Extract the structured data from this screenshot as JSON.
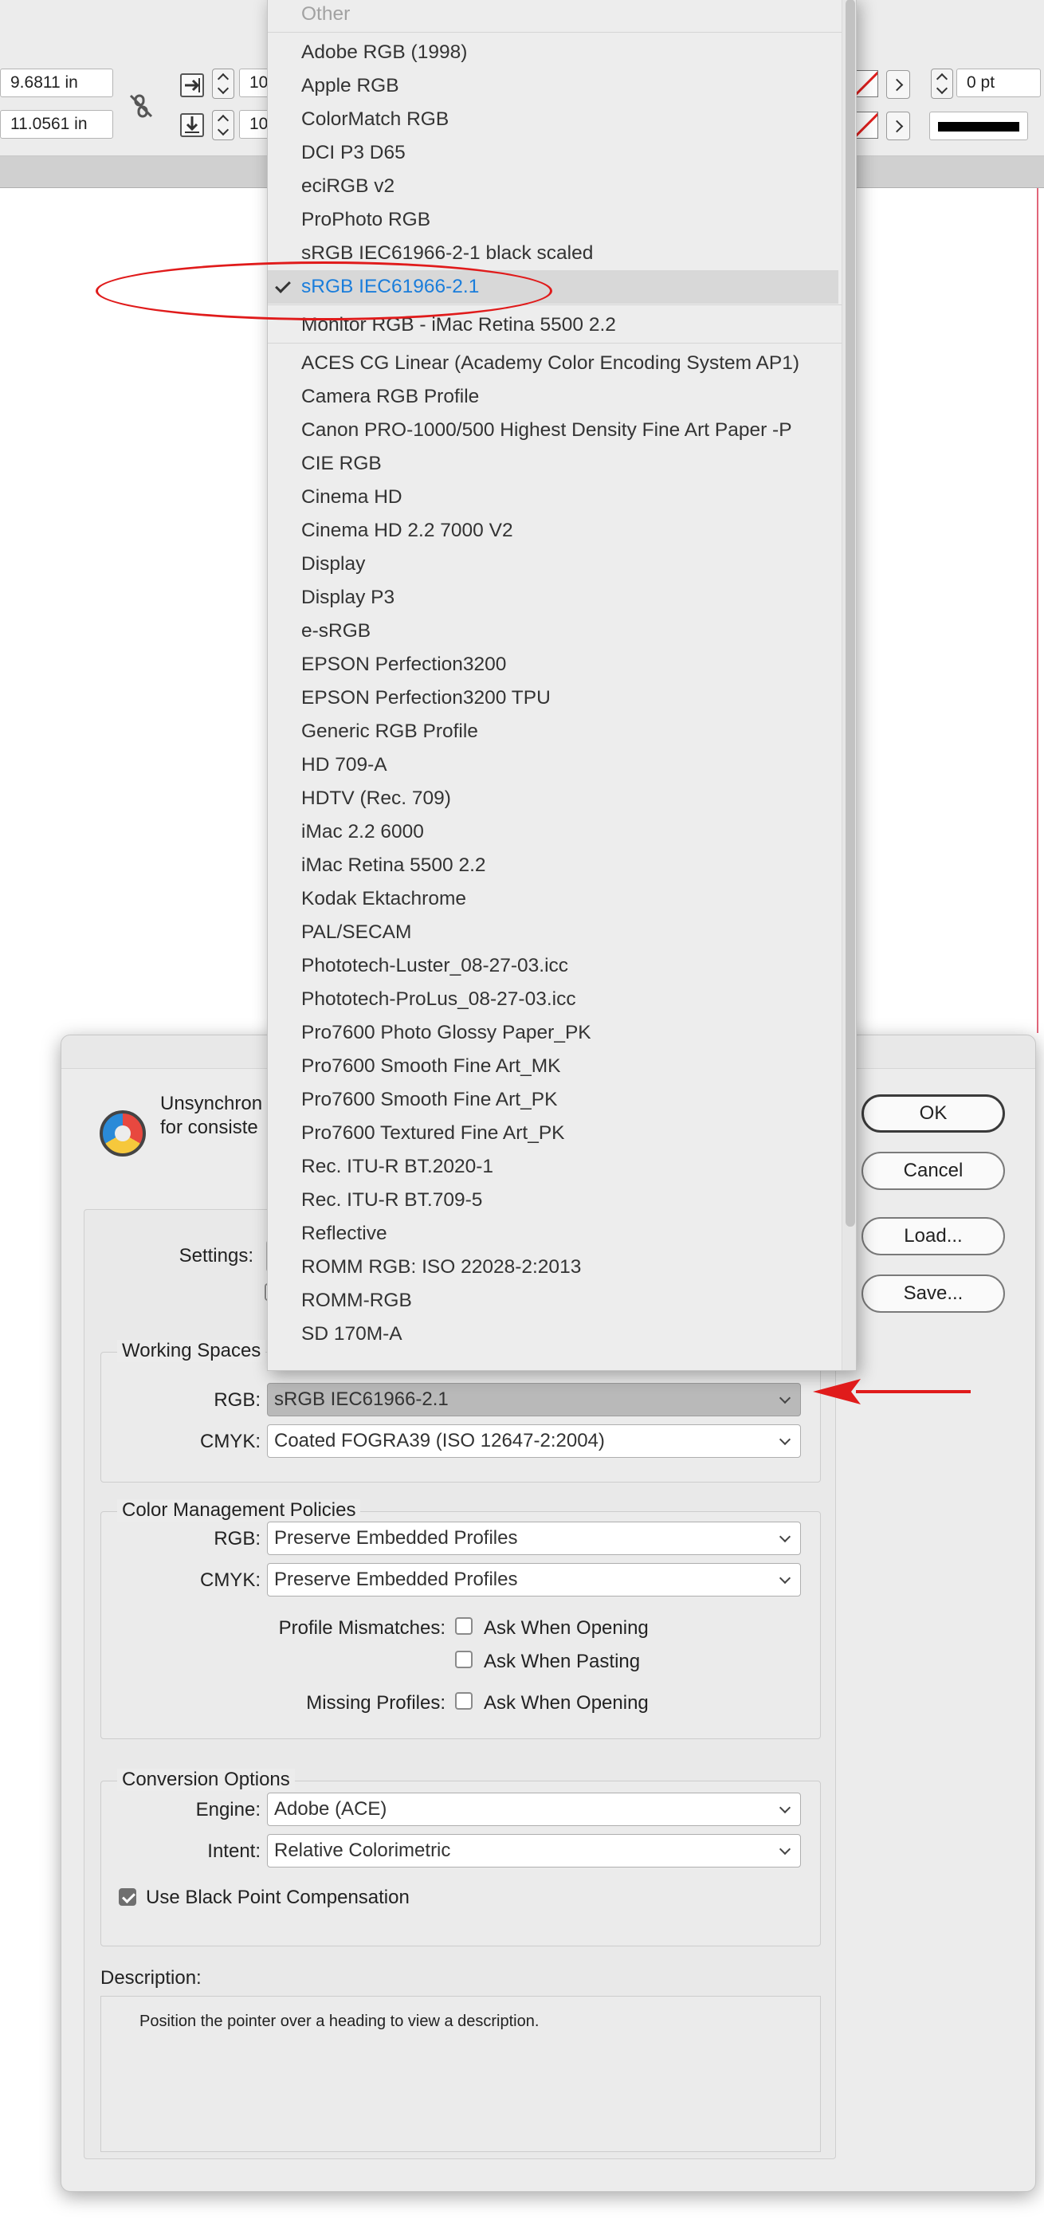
{
  "toolbar": {
    "width_value": "9.6811 in",
    "height_value": "11.0561 in",
    "field_top_value": "10",
    "field_bottom_value": "10",
    "stroke_weight": "0 pt",
    "icons": [
      "constrain-proportions-icon",
      "transform-x-icon",
      "transform-y-icon",
      "stroke-swatch-icon",
      "fill-swatch-icon"
    ]
  },
  "dialog": {
    "message_line1": "Unsynchron",
    "message_line2": "for consiste",
    "buttons": {
      "ok": "OK",
      "cancel": "Cancel",
      "load": "Load...",
      "save": "Save..."
    },
    "settings_label": "Settings:",
    "working_spaces": {
      "title": "Working Spaces",
      "rgb_label": "RGB:",
      "rgb_value": "sRGB IEC61966-2.1",
      "cmyk_label": "CMYK:",
      "cmyk_value": "Coated FOGRA39 (ISO 12647-2:2004)"
    },
    "policies": {
      "title": "Color Management Policies",
      "rgb_label": "RGB:",
      "rgb_value": "Preserve Embedded Profiles",
      "cmyk_label": "CMYK:",
      "cmyk_value": "Preserve Embedded Profiles",
      "mismatch_label": "Profile Mismatches:",
      "ask_opening": "Ask When Opening",
      "ask_pasting": "Ask When Pasting",
      "missing_label": "Missing Profiles:",
      "missing_ask_opening": "Ask When Opening"
    },
    "conversion": {
      "title": "Conversion Options",
      "engine_label": "Engine:",
      "engine_value": "Adobe (ACE)",
      "intent_label": "Intent:",
      "intent_value": "Relative Colorimetric",
      "bpc_label": "Use Black Point Compensation",
      "bpc_checked": true
    },
    "description": {
      "label": "Description:",
      "text": "Position the pointer over a heading to view a description."
    }
  },
  "menu": {
    "header": "Other",
    "group1": [
      "Adobe RGB (1998)",
      "Apple RGB",
      "ColorMatch RGB",
      "DCI P3 D65",
      "eciRGB v2",
      "ProPhoto RGB",
      "sRGB IEC61966-2-1 black scaled"
    ],
    "selected": "sRGB IEC61966-2.1",
    "monitor": "Monitor RGB - iMac Retina 5500 2.2",
    "group2": [
      "ACES CG Linear (Academy Color Encoding System AP1)",
      "Camera RGB Profile",
      "Canon PRO-1000/500 Highest Density Fine Art Paper -P",
      "CIE RGB",
      "Cinema HD",
      "Cinema HD 2.2 7000 V2",
      "Display",
      "Display P3",
      "e-sRGB",
      "EPSON Perfection3200",
      "EPSON Perfection3200 TPU",
      "Generic RGB Profile",
      "HD 709-A",
      "HDTV (Rec. 709)",
      "iMac 2.2 6000",
      "iMac Retina 5500 2.2",
      "Kodak Ektachrome",
      "PAL/SECAM",
      "Phototech-Luster_08-27-03.icc",
      "Phototech-ProLus_08-27-03.icc",
      "Pro7600 Photo Glossy Paper_PK",
      "Pro7600 Smooth Fine Art_MK",
      "Pro7600 Smooth Fine Art_PK",
      "Pro7600 Textured Fine Art_PK",
      "Rec. ITU-R BT.2020-1",
      "Rec. ITU-R BT.709-5",
      "Reflective",
      "ROMM RGB: ISO 22028-2:2013",
      "ROMM-RGB",
      "SD 170M-A"
    ]
  },
  "annotations": {
    "highlight_color": "#e01b1b",
    "arrow_color": "#e01b1b"
  },
  "colors": {
    "selected_text": "#1a7ddb",
    "dialog_bg": "#ececec"
  }
}
